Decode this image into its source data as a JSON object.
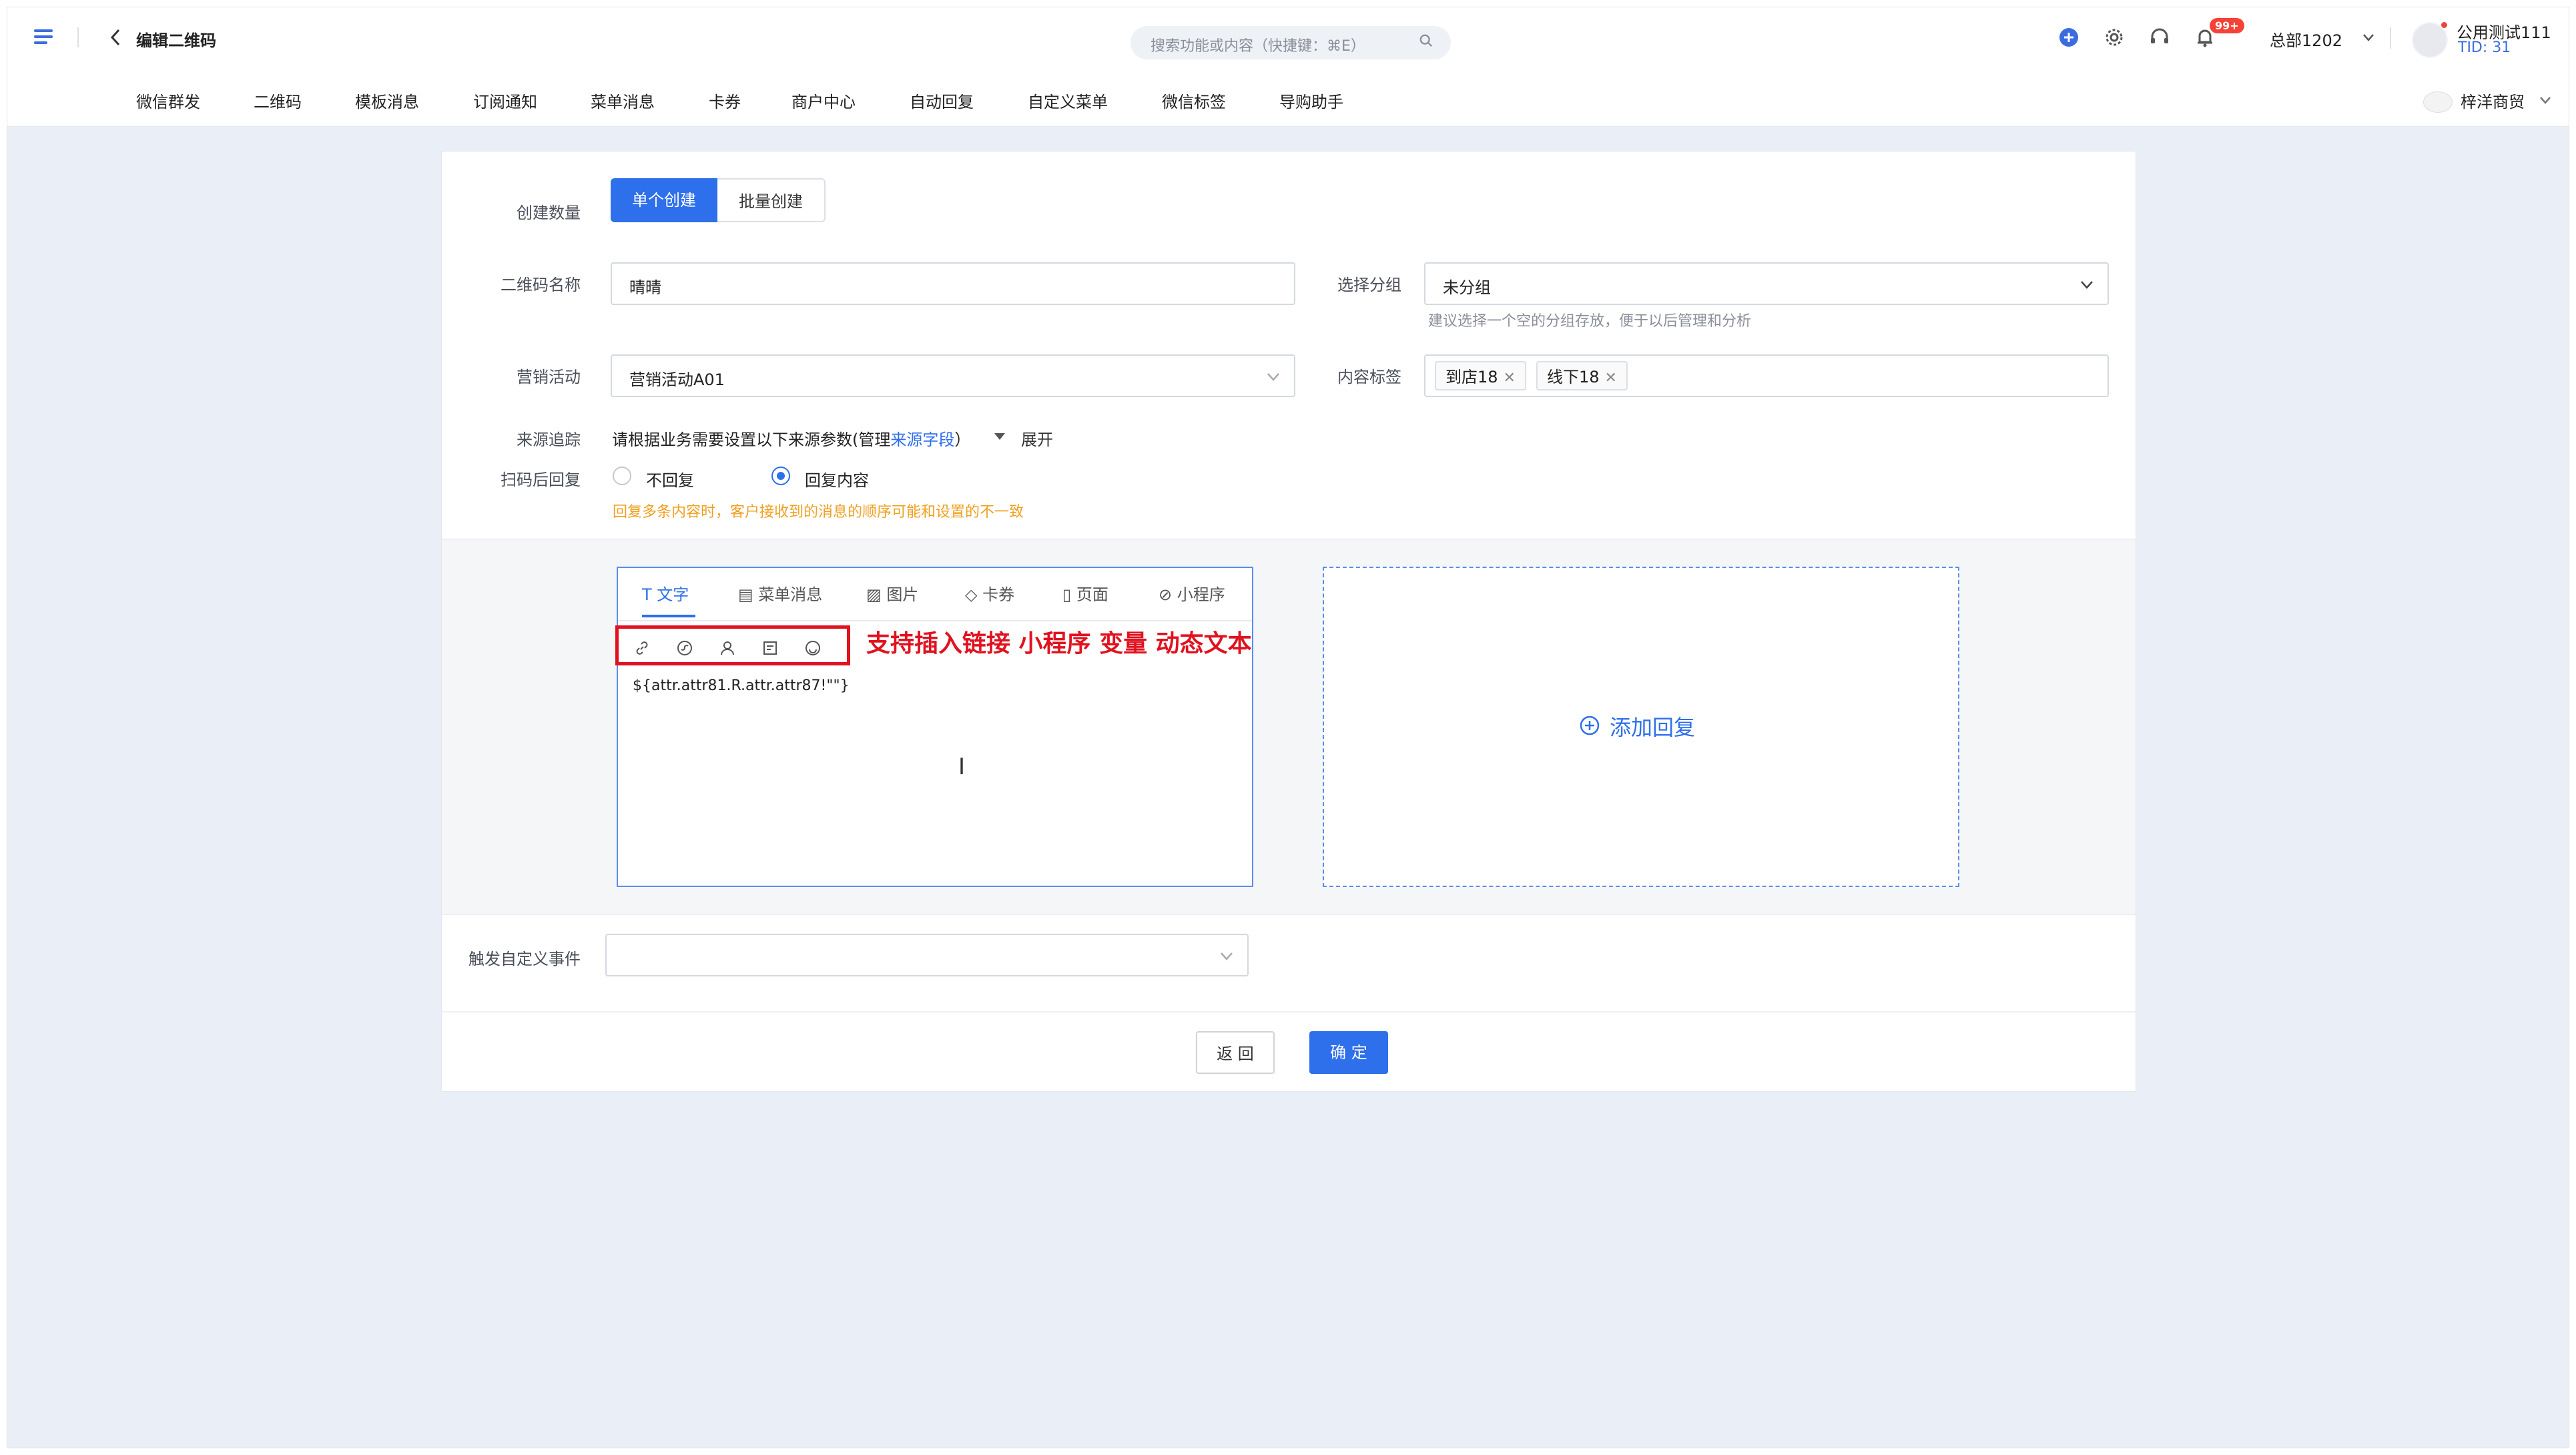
{
  "header": {
    "title": "编辑二维码",
    "search_placeholder": "搜索功能或内容（快捷键：⌘E）",
    "notification_badge": "99+",
    "org": "总部1202",
    "user_name": "公用测试111",
    "user_tid": "TID: 31"
  },
  "nav": {
    "items": [
      "微信群发",
      "二维码",
      "模板消息",
      "订阅通知",
      "菜单消息",
      "卡券",
      "商户中心",
      "自动回复",
      "自定义菜单",
      "微信标签",
      "导购助手"
    ],
    "merchant": "梓洋商贸"
  },
  "form": {
    "create_count_label": "创建数量",
    "single_create": "单个创建",
    "batch_create": "批量创建",
    "qr_name_label": "二维码名称",
    "qr_name_value": "晴晴",
    "group_label": "选择分组",
    "group_value": "未分组",
    "group_hint": "建议选择一个空的分组存放，便于以后管理和分析",
    "campaign_label": "营销活动",
    "campaign_value": "营销活动A01",
    "content_tag_label": "内容标签",
    "tags": [
      "到店18",
      "线下18"
    ],
    "source_label": "来源追踪",
    "source_text": "请根据业务需要设置以下来源参数(管理",
    "source_link": "来源字段",
    "source_close": "）",
    "expand": "展开",
    "scan_reply_label": "扫码后回复",
    "no_reply": "不回复",
    "reply_content": "回复内容",
    "reply_warning": "回复多条内容时，客户接收到的消息的顺序可能和设置的不一致"
  },
  "editor": {
    "tabs": [
      "文字",
      "菜单消息",
      "图片",
      "卡券",
      "页面",
      "小程序"
    ],
    "active_tab": "文字",
    "callout": "支持插入链接 小程序 变量 动态文本",
    "content": "${attr.attr81.R.attr.attr87!\"\"}",
    "add_reply": "添加回复"
  },
  "event": {
    "label": "触发自定义事件",
    "value": ""
  },
  "buttons": {
    "back": "返 回",
    "confirm": "确 定"
  },
  "colors": {
    "primary": "#2e6fec",
    "highlight_red": "#e0121f",
    "warning": "#f0a020"
  }
}
